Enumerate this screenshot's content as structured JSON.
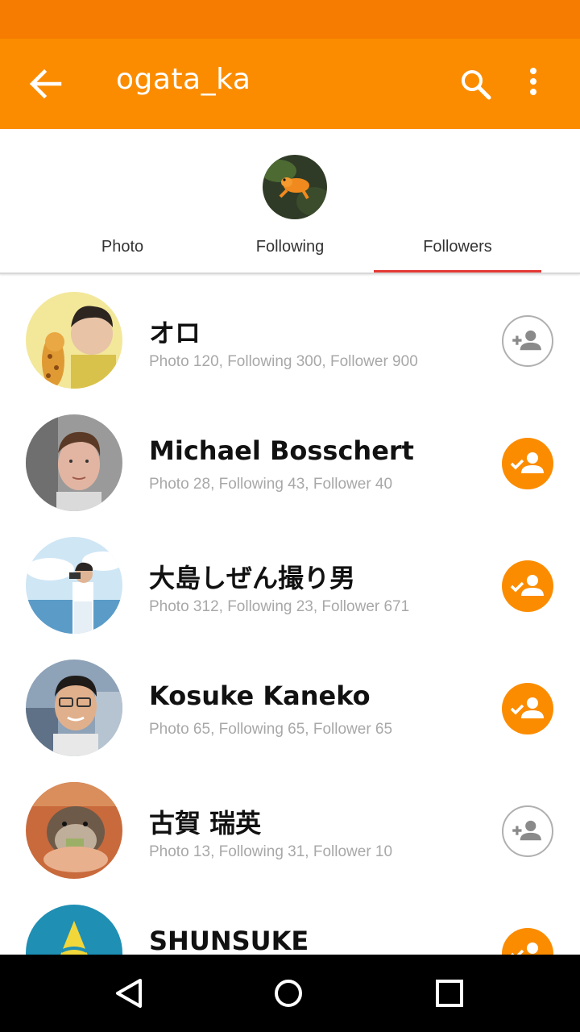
{
  "app_bar": {
    "title": "ogata_ka",
    "back_icon": "arrow-back-icon",
    "search_icon": "search-icon",
    "more_icon": "more-vert-icon",
    "color": "#fb8c00"
  },
  "status_bar": {
    "color": "#f57c00"
  },
  "tabs": [
    {
      "label": "Photo",
      "active": false
    },
    {
      "label": "Following",
      "active": false
    },
    {
      "label": "Followers",
      "active": true
    }
  ],
  "followers": [
    {
      "name": "オロ",
      "stats": "Photo 120,  Following 300, Follower 900",
      "following": false
    },
    {
      "name": "Michael Bosschert",
      "stats": "Photo 28,  Following 43, Follower 40",
      "following": true
    },
    {
      "name": "大島しぜん撮り男",
      "stats": "Photo 312,  Following 23, Follower 671",
      "following": true
    },
    {
      "name": "Kosuke Kaneko",
      "stats": "Photo 65, Following 65, Follower 65",
      "following": true
    },
    {
      "name": "古賀 瑞英",
      "stats": "Photo 13,  Following 31, Follower 10",
      "following": false
    },
    {
      "name": "SHUNSUKE",
      "stats": "",
      "following": true
    }
  ],
  "colors": {
    "accent": "#fb8c00",
    "tab_indicator": "#e53935"
  },
  "nav_bar": {
    "back_icon": "nav-back-icon",
    "home_icon": "nav-home-icon",
    "recent_icon": "nav-recent-icon"
  }
}
